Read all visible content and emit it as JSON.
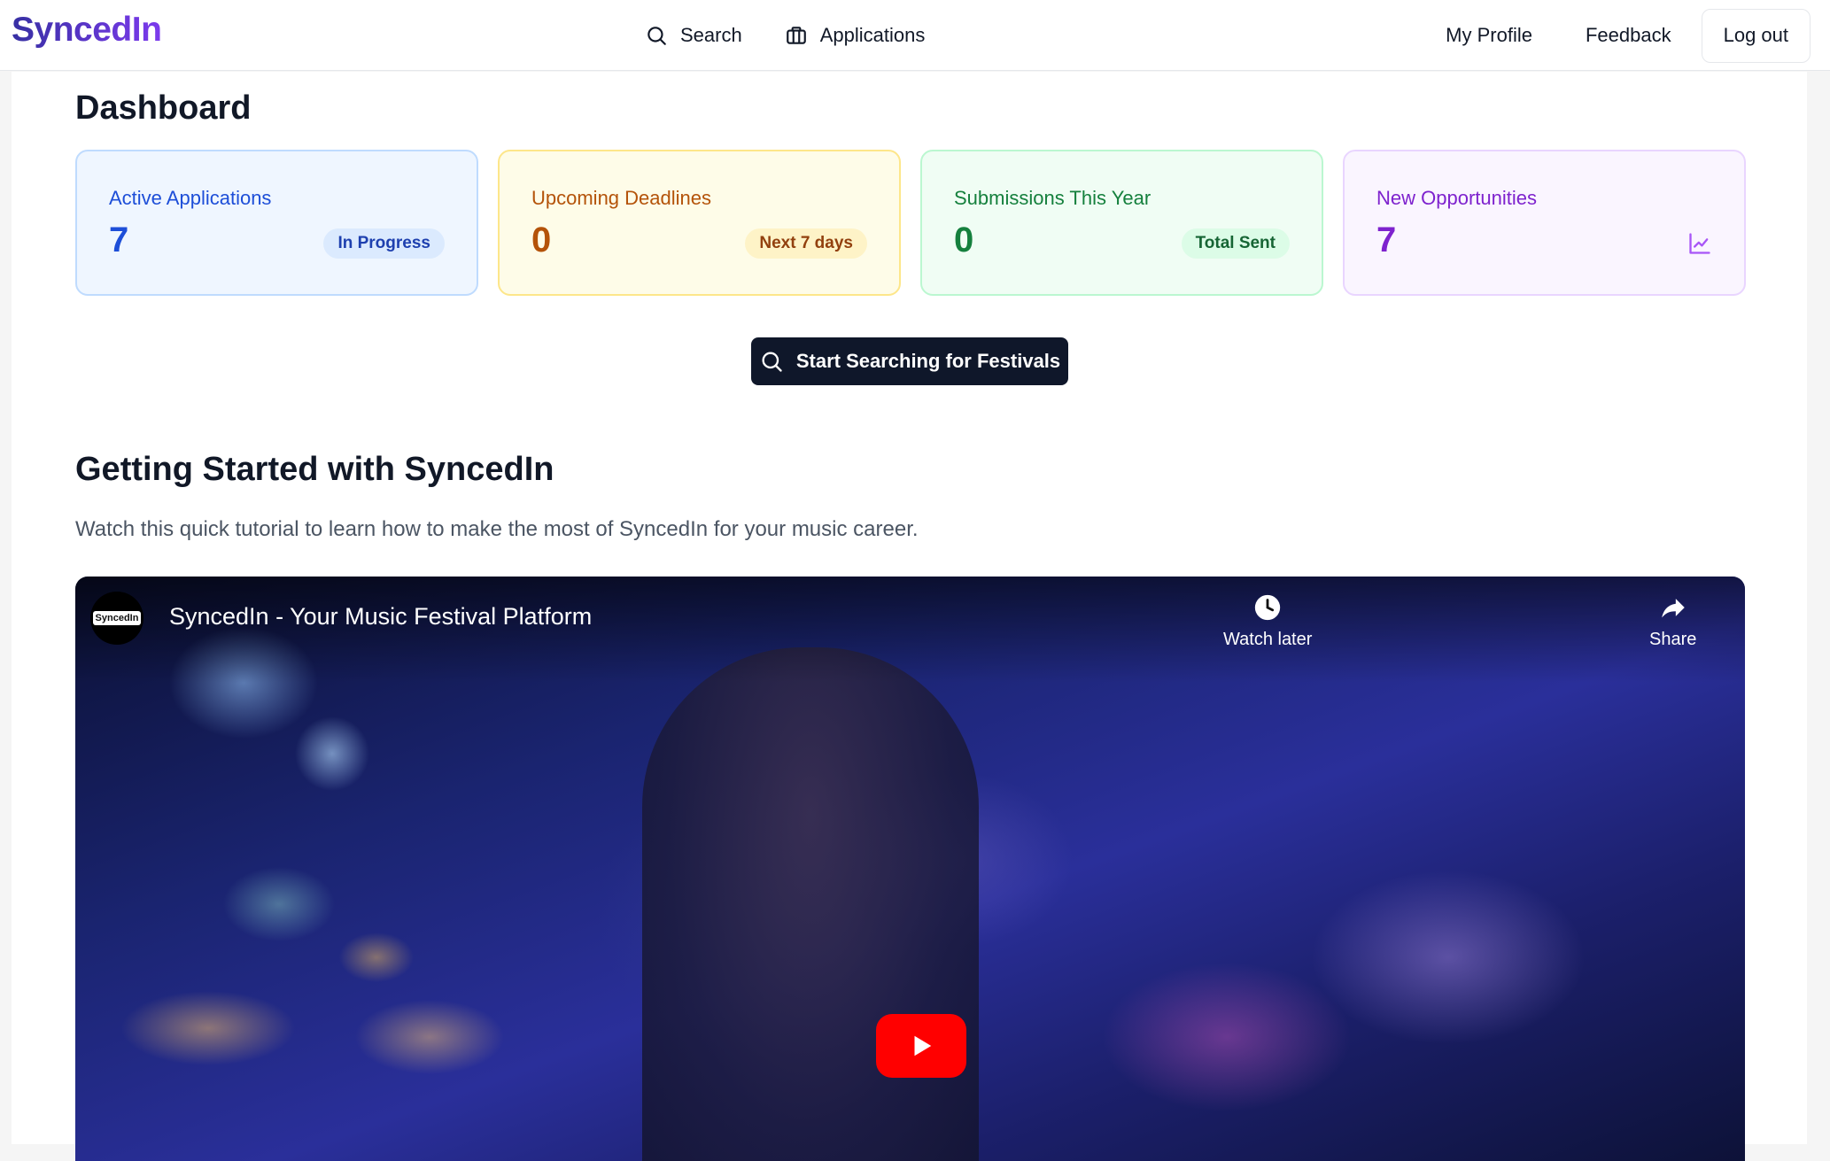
{
  "app": {
    "logo": "SyncedIn"
  },
  "nav": {
    "search_label": "Search",
    "applications_label": "Applications",
    "profile_label": "My Profile",
    "feedback_label": "Feedback",
    "logout_label": "Log out"
  },
  "dashboard": {
    "title": "Dashboard",
    "cards": [
      {
        "label": "Active Applications",
        "value": "7",
        "badge": "In Progress"
      },
      {
        "label": "Upcoming Deadlines",
        "value": "0",
        "badge": "Next 7 days"
      },
      {
        "label": "Submissions This Year",
        "value": "0",
        "badge": "Total Sent"
      },
      {
        "label": "New Opportunities",
        "value": "7",
        "icon": "chart-line-icon"
      }
    ],
    "cta_label": "Start Searching for Festivals"
  },
  "getting_started": {
    "title": "Getting Started with SyncedIn",
    "description": "Watch this quick tutorial to learn how to make the most of SyncedIn for your music career."
  },
  "video": {
    "channel_avatar_text": "SyncedIn",
    "title": "SyncedIn - Your Music Festival Platform",
    "watch_later_label": "Watch later",
    "share_label": "Share"
  },
  "colors": {
    "blue": "#1d4ed8",
    "yellow": "#b45309",
    "green": "#15803d",
    "purple": "#7e22ce",
    "cta_bg": "#0f172a",
    "play_red": "#ff0000"
  }
}
